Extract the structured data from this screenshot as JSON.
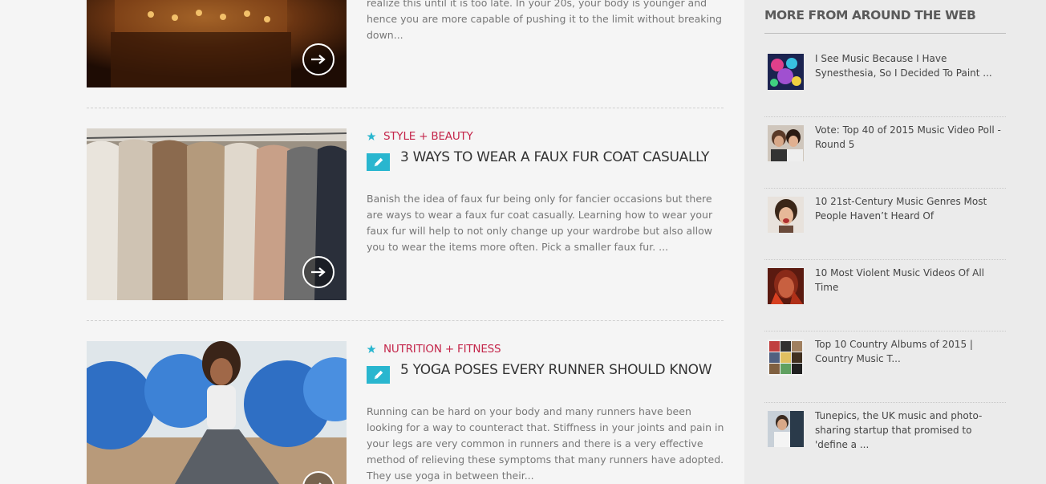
{
  "posts": [
    {
      "category": "",
      "title": "",
      "excerpt": "realize this until it is too late. In your 20s, your body is younger and hence you are more capable of pushing it to the limit without breaking down...",
      "image": "cake-photo"
    },
    {
      "category": "Style + Beauty",
      "title": "3 Ways to Wear a Faux Fur Coat Casually",
      "excerpt": "Banish the idea of faux fur being only for fancier occasions but there are ways to wear a faux fur coat casually. Learning how to wear your faux fur will help to not only change up your wardrobe but also allow you to wear the items more often.   Pick a smaller faux fur.  ...",
      "image": "fur-coats-photo"
    },
    {
      "category": "Nutrition + Fitness",
      "title": "5 Yoga Poses Every Runner Should Know",
      "excerpt": "Running can be hard on your body and many runners have been looking for a way to counteract that. Stiffness in your joints and pain in your legs are very common in runners and there is a very effective method of relieving these symptoms that many runners have adopted. They use yoga in between their...",
      "image": "yoga-photo"
    }
  ],
  "sidebar": {
    "heading": "More from around the web",
    "items": [
      {
        "text": "I See Music Because I Have Synesthesia, So I Decided To Paint ..."
      },
      {
        "text": "Vote: Top 40 of 2015 Music Video Poll - Round 5"
      },
      {
        "text": "10 21st-Century Music Genres Most People Haven’t Heard Of"
      },
      {
        "text": "10 Most Violent Music Videos Of All Time"
      },
      {
        "text": "Top 10 Country Albums of 2015 | Country Music T..."
      },
      {
        "text": "Tunepics, the UK music and photo-sharing startup that promised to 'define a ..."
      }
    ]
  },
  "colors": {
    "category_red": "#c4254a",
    "accent_teal": "#29b6cf",
    "title_dark": "#333333",
    "sidebar_bg": "#ebebeb"
  }
}
